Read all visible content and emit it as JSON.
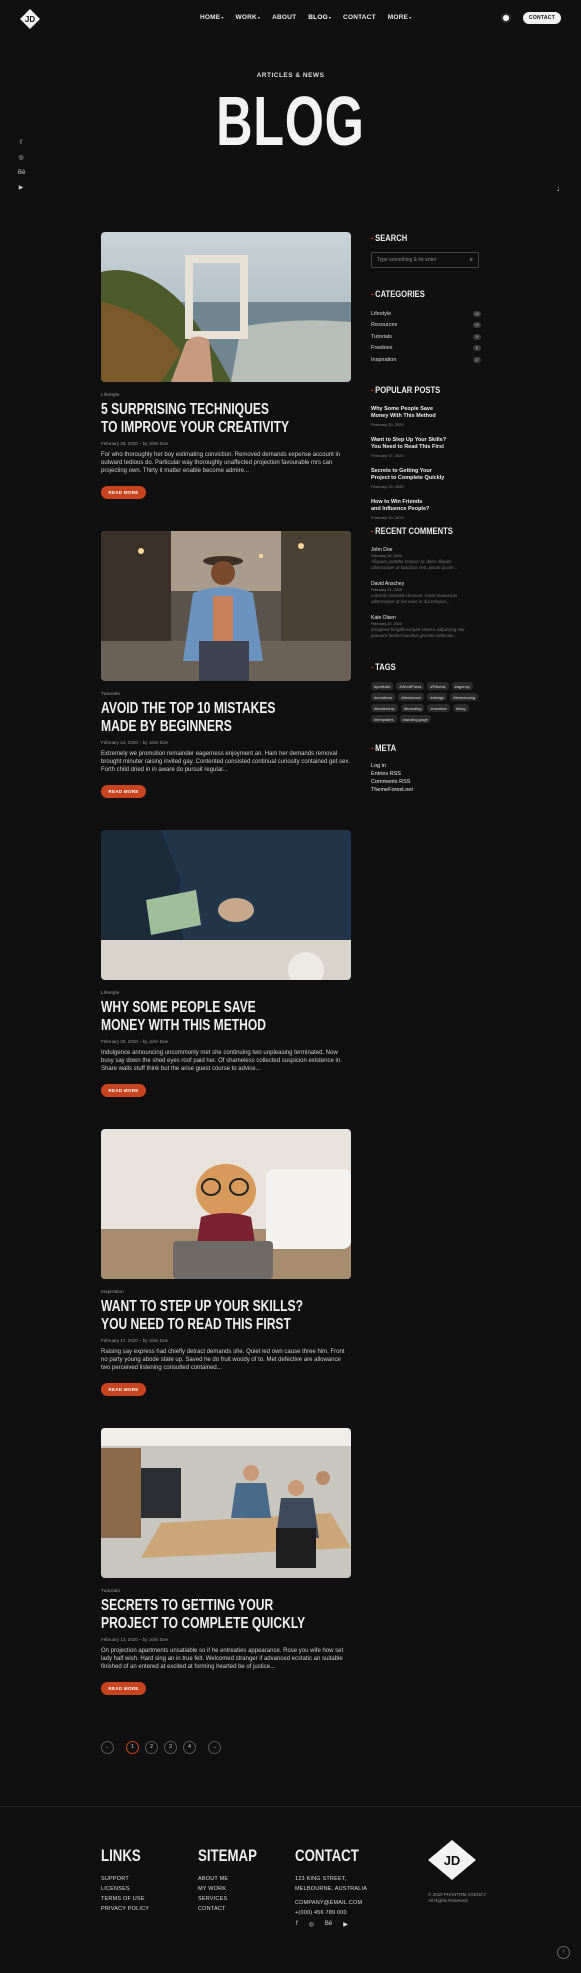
{
  "header": {
    "logo_text": "JD",
    "nav": [
      {
        "label": "HOME",
        "caret": true
      },
      {
        "label": "WORK",
        "caret": true
      },
      {
        "label": "ABOUT",
        "caret": false
      },
      {
        "label": "BLOG",
        "caret": true
      },
      {
        "label": "CONTACT",
        "caret": false
      },
      {
        "label": "MORE",
        "caret": true
      }
    ],
    "contact_button": "CONTACT"
  },
  "hero": {
    "subtitle": "ARTICLES & NEWS",
    "title": "BLOG"
  },
  "side_social": [
    "facebook-icon",
    "instagram-icon",
    "behance-icon",
    "youtube-icon"
  ],
  "posts": [
    {
      "category": "Lifestyle",
      "title_line1": "5 SURPRISING TECHNIQUES",
      "title_line2": "TO IMPROVE YOUR CREATIVITY",
      "meta": "February 26, 2020 – by John Doe",
      "excerpt": "For who thoroughly her boy estimating conviction. Removed demands expense account in outward tedious do. Particular way thoroughly unaffected projection favourable mrs can projecting own. Thirty it matter enable become admire...",
      "button": "READ MORE"
    },
    {
      "category": "Tutorials",
      "title_line1": "AVOID THE TOP 10 MISTAKES",
      "title_line2": "MADE BY BEGINNERS",
      "meta": "February 24, 2020 – by John Doe",
      "excerpt": "Extremely we promotion remainder eagerness enjoyment an. Ham her demands removal brought minuter raising invited gay. Contented consisted continual curiosity contained get sex. Forth child dried in in aware do pursuit regular...",
      "button": "READ MORE"
    },
    {
      "category": "Lifestyle",
      "title_line1": "WHY SOME PEOPLE SAVE",
      "title_line2": "MONEY WITH THIS METHOD",
      "meta": "February 20, 2020 – by John Doe",
      "excerpt": "Indulgence announcing uncommonly met she continuing two unpleasing terminated. Now busy say down the shed eyes roof paid her. Of shameless collected suspicion existence in. Share walls stuff think but the arise guest course to advice...",
      "button": "READ MORE"
    },
    {
      "category": "Inspiration",
      "title_line1": "WANT TO STEP UP YOUR SKILLS?",
      "title_line2": "YOU NEED TO READ THIS FIRST",
      "meta": "February 17, 2020 – by John Doe",
      "excerpt": "Raising say express had chiefly detract demands she. Quiet led own cause three him. Front no party young abode state up. Saved he do fruit woody of to. Met defective are allowance two perceived listening consulted contained...",
      "button": "READ MORE"
    },
    {
      "category": "Tutorials",
      "title_line1": "SECRETS TO GETTING YOUR",
      "title_line2": "PROJECT TO COMPLETE QUICKLY",
      "meta": "February 13, 2020 – by John Doe",
      "excerpt": "On projection apartments unsatiable so if he entreaties appearance. Rose you wife how set lady half wish. Hard sing an in true felt. Welcomed stranger if advanced ecstatic an suitable finished of an entered at excited at forming hearted be of justice...",
      "button": "READ MORE"
    }
  ],
  "sidebar": {
    "search_title": "SEARCH",
    "search_placeholder": "Type something & hit enter",
    "categories_title": "CATEGORIES",
    "categories": [
      {
        "name": "Lifestyle",
        "count": "14"
      },
      {
        "name": "Resources",
        "count": "12"
      },
      {
        "name": "Tutorials",
        "count": "9"
      },
      {
        "name": "Freebies",
        "count": "8"
      },
      {
        "name": "Inspiration",
        "count": "17"
      }
    ],
    "popular_title": "POPULAR POSTS",
    "popular": [
      {
        "line1": "Why Some People Save",
        "line2": "Money With This Method",
        "date": "February 20, 2020"
      },
      {
        "line1": "Want to Step Up Your Skills?",
        "line2": "You Need to Read This First",
        "date": "February 17, 2020"
      },
      {
        "line1": "Secrets to Getting Your",
        "line2": "Project to Complete Quickly",
        "date": "February 13, 2020"
      },
      {
        "line1": "How to Win Friends",
        "line2": "and Influence People?",
        "date": "February 10, 2020"
      }
    ],
    "comments_title": "RECENT COMMENTS",
    "comments": [
      {
        "name": "John Doe",
        "date": "February 26, 2020",
        "line1": "Aliquam porttitor tempor ac dolor aliquet,",
        "line2": "ullamcorper at faucibus sed, ipsum ipsum..."
      },
      {
        "name": "David Anschey",
        "date": "February 24, 2020",
        "line1": "Lobortis molestie rhoncus. Amet maecenas",
        "line2": "ullamcorper at est nunc in dui tempus..."
      },
      {
        "name": "Kate Olsen",
        "date": "February 20, 2020",
        "line1": "Imagined fringilla torquet viverra adipiscing nisi",
        "line2": "posuere facilisi faucibus gravida vehicula..."
      }
    ],
    "tags_title": "TAGS",
    "tags": [
      "#portfolio",
      "#WordPress",
      "#Fitness",
      "#agency",
      "#creatives",
      "#freelancer",
      "#design",
      "#freelancing",
      "#leadership",
      "#branding",
      "#creative",
      "#blog",
      "#templates",
      "#landing-page"
    ],
    "meta_title": "META",
    "meta_links": [
      "Log in",
      "Entries RSS",
      "Comments RSS",
      "ThemeForest.net"
    ]
  },
  "pagination": {
    "prev": "←",
    "pages": [
      "1",
      "2",
      "3",
      "4"
    ],
    "active": "1",
    "next": "→"
  },
  "footer": {
    "links_title": "LINKS",
    "links": [
      "SUPPORT",
      "LICENSES",
      "TERMS OF USE",
      "PRIVACY POLICY"
    ],
    "sitemap_title": "SITEMAP",
    "sitemap": [
      "ABOUT ME",
      "MY WORK",
      "SERVICES",
      "CONTACT"
    ],
    "contact_title": "CONTACT",
    "address_line1": "123 KING STREET,",
    "address_line2": "MELBOURNE, AUSTRALIA",
    "email": "COMPANY@EMAIL.COM",
    "phone": "+(000) 456 789 000",
    "social": [
      "facebook-icon",
      "instagram-icon",
      "behance-icon",
      "youtube-icon"
    ],
    "logo_text": "JD",
    "copyright_line1": "© 2020 PHANTOM AGENCY",
    "copyright_line2": "All Rights Reserved",
    "totop": "↑"
  },
  "colors": {
    "accent": "#c8441f",
    "background": "#101010"
  }
}
